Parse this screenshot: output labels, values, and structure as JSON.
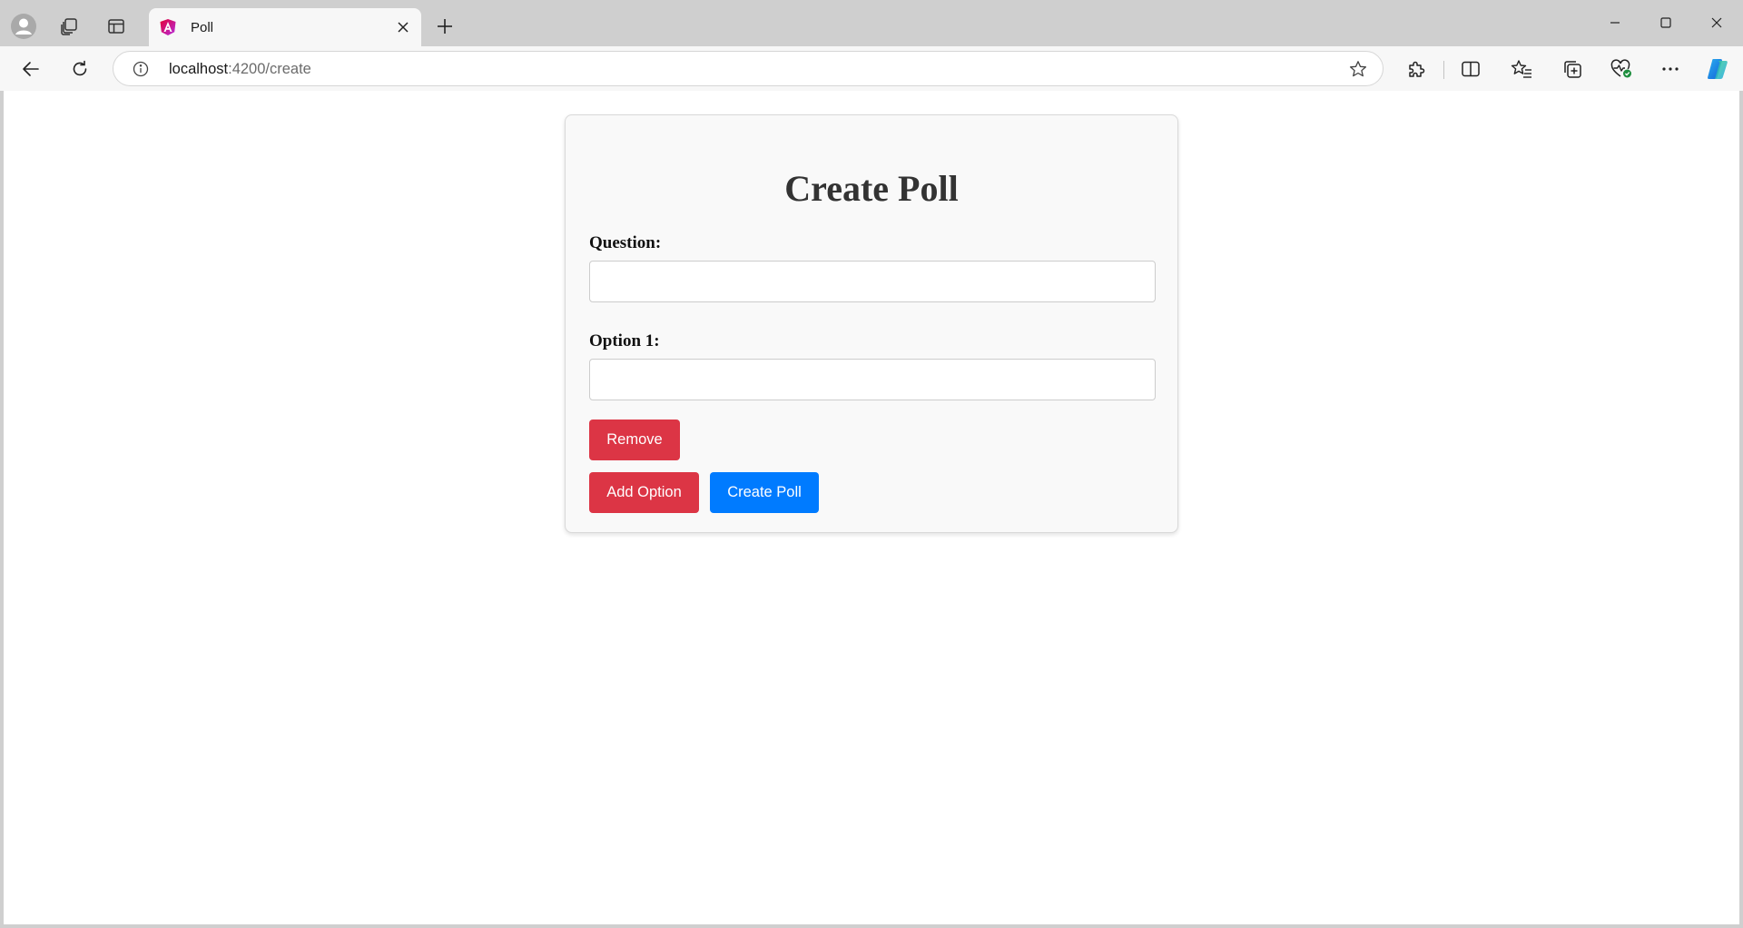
{
  "browser": {
    "tab": {
      "title": "Poll",
      "favicon": "angular-logo-icon"
    },
    "address_bar": {
      "host": "localhost",
      "path": ":4200/create"
    },
    "icons": {
      "profile": "avatar-icon",
      "workspaces": "workspaces-icon",
      "tab_actions": "tab-actions-icon",
      "new_tab": "plus-icon",
      "back": "back-arrow-icon",
      "reload": "reload-icon",
      "site_info": "info-icon",
      "favorite": "star-icon",
      "extensions": "puzzle-icon",
      "split_screen": "split-screen-icon",
      "favorites": "favorites-icon",
      "collections": "collections-icon",
      "browser_essentials": "heart-pulse-icon",
      "more": "more-dots-icon",
      "copilot": "copilot-icon"
    }
  },
  "page": {
    "title": "Create Poll",
    "question_label": "Question:",
    "question_value": "",
    "options": [
      {
        "label": "Option 1:",
        "value": ""
      }
    ],
    "remove_label": "Remove",
    "add_option_label": "Add Option",
    "create_poll_label": "Create Poll"
  },
  "colors": {
    "danger": "#dc3545",
    "primary": "#007bff",
    "card_bg": "#f9f9f9",
    "title_text": "#333333"
  }
}
